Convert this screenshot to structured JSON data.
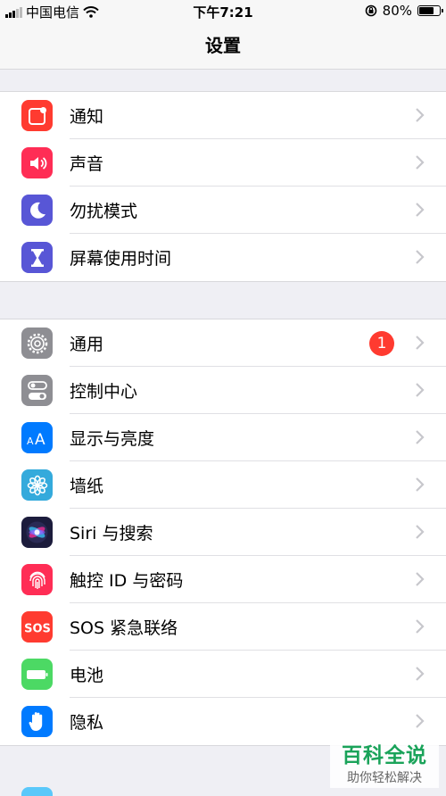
{
  "status": {
    "carrier": "中国电信",
    "time": "下午7:21",
    "battery_percent": "80%",
    "battery_level": 0.8
  },
  "nav": {
    "title": "设置"
  },
  "groups": [
    [
      {
        "label": "通知",
        "icon": "notifications-icon",
        "color": "#ff3b30"
      },
      {
        "label": "声音",
        "icon": "speaker-icon",
        "color": "#ff2d55"
      },
      {
        "label": "勿扰模式",
        "icon": "moon-icon",
        "color": "#5856d6"
      },
      {
        "label": "屏幕使用时间",
        "icon": "hourglass-icon",
        "color": "#5856d6"
      }
    ],
    [
      {
        "label": "通用",
        "icon": "gear-icon",
        "color": "#8e8e93",
        "badge": "1"
      },
      {
        "label": "控制中心",
        "icon": "toggles-icon",
        "color": "#8e8e93"
      },
      {
        "label": "显示与亮度",
        "icon": "text-size-icon",
        "color": "#007aff"
      },
      {
        "label": "墙纸",
        "icon": "flower-icon",
        "color": "#34aadc"
      },
      {
        "label": "Siri 与搜索",
        "icon": "siri-icon",
        "color": "#1c1c3c"
      },
      {
        "label": "触控 ID 与密码",
        "icon": "fingerprint-icon",
        "color": "#ff2d55"
      },
      {
        "label": "SOS 紧急联络",
        "icon": "sos-icon",
        "color": "#ff3b30"
      },
      {
        "label": "电池",
        "icon": "battery-icon",
        "color": "#4cd964"
      },
      {
        "label": "隐私",
        "icon": "hand-icon",
        "color": "#007aff"
      }
    ]
  ],
  "watermark": {
    "title": "百科全说",
    "subtitle": "助你轻松解决"
  }
}
